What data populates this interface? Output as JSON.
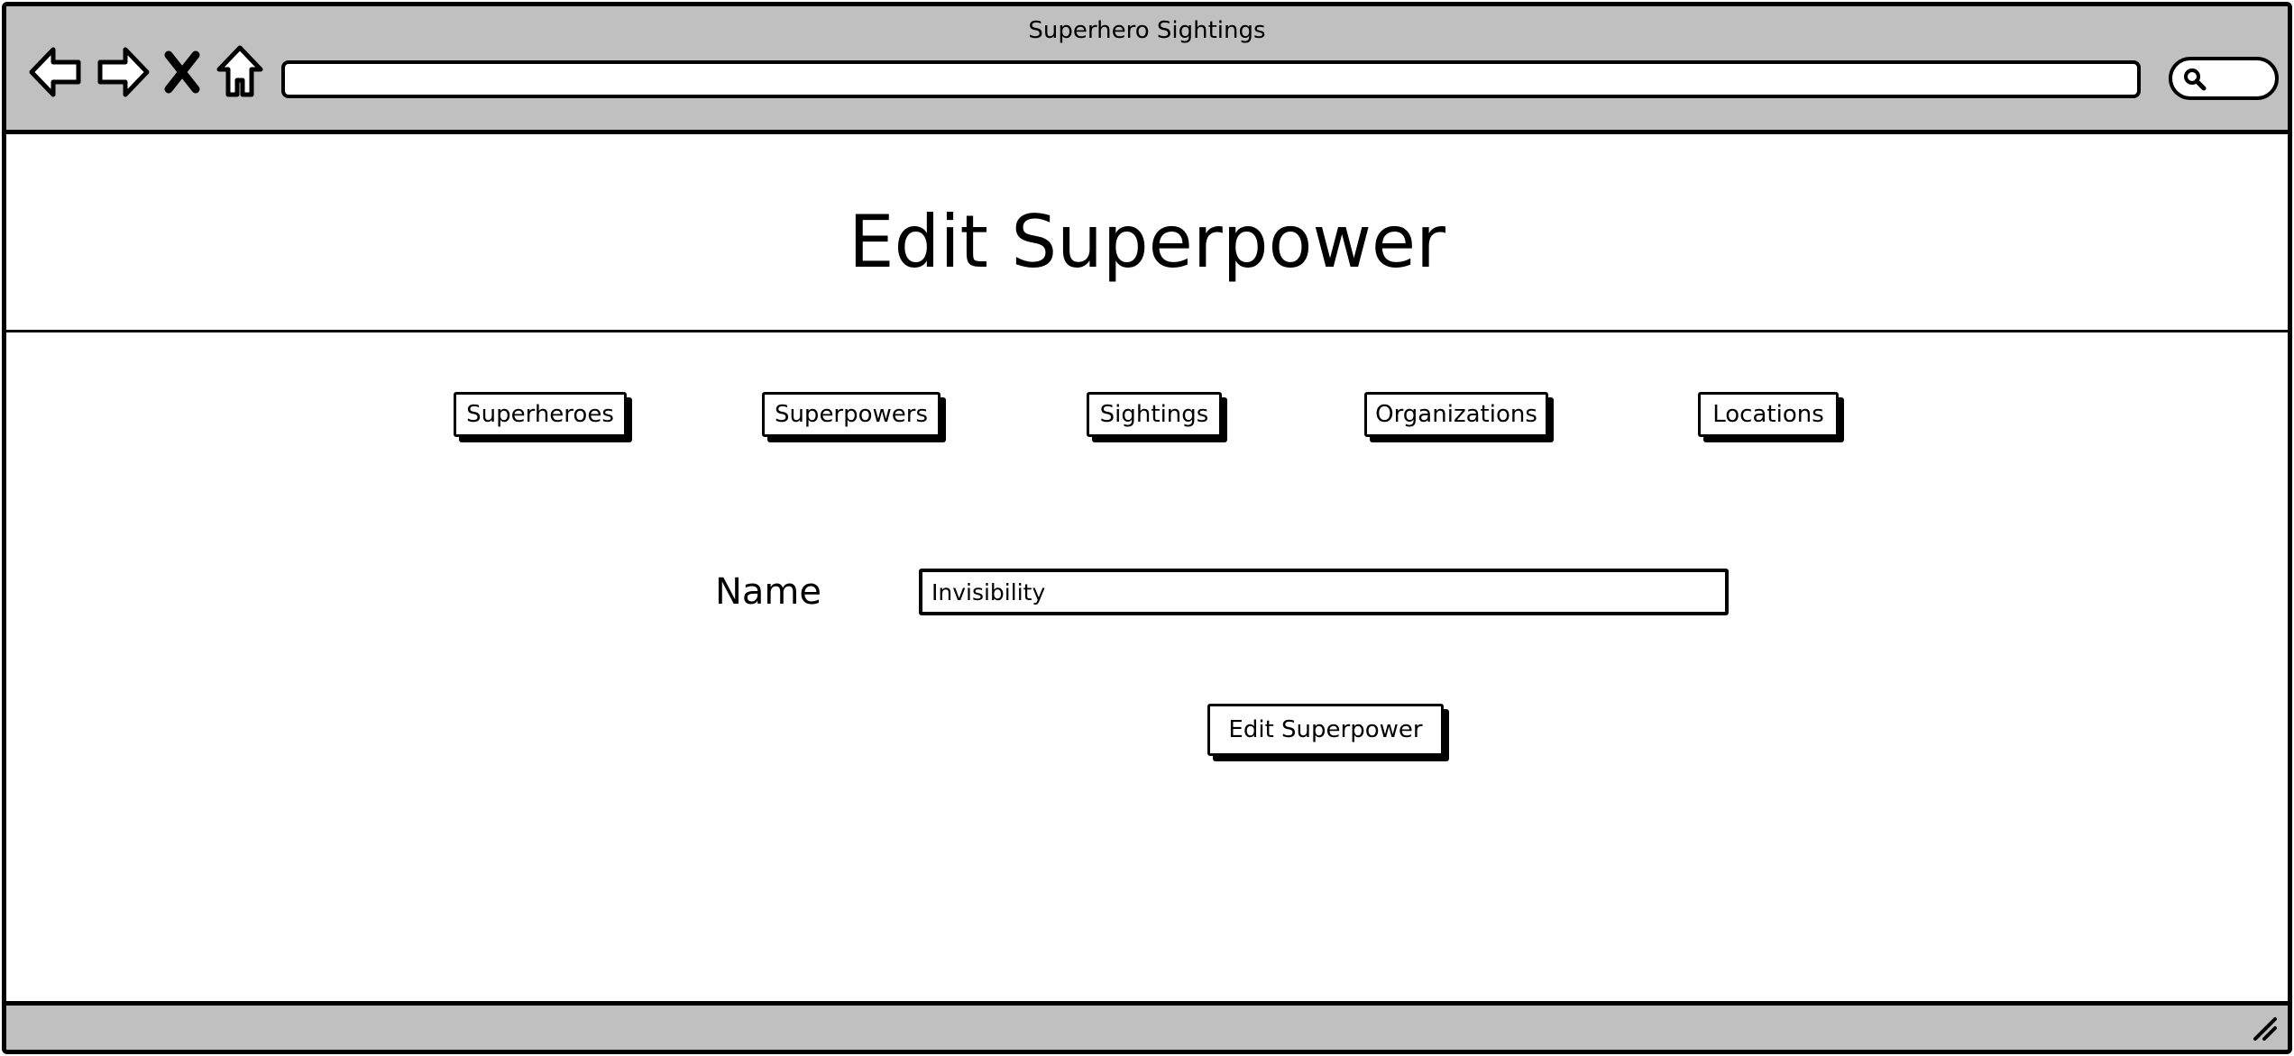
{
  "window": {
    "title": "Superhero Sightings"
  },
  "browser": {
    "address_value": "",
    "icons": {
      "back": "arrow-left-icon",
      "forward": "arrow-right-icon",
      "stop": "close-icon",
      "home": "home-icon",
      "search": "search-icon",
      "resize": "resize-grip-icon"
    }
  },
  "header": {
    "title": "Edit Superpower"
  },
  "nav": {
    "items": [
      {
        "label": "Superheroes"
      },
      {
        "label": "Superpowers"
      },
      {
        "label": "Sightings"
      },
      {
        "label": "Organizations"
      },
      {
        "label": "Locations"
      }
    ]
  },
  "form": {
    "name_label": "Name",
    "name_value": "Invisibility",
    "submit_label": "Edit Superpower"
  }
}
